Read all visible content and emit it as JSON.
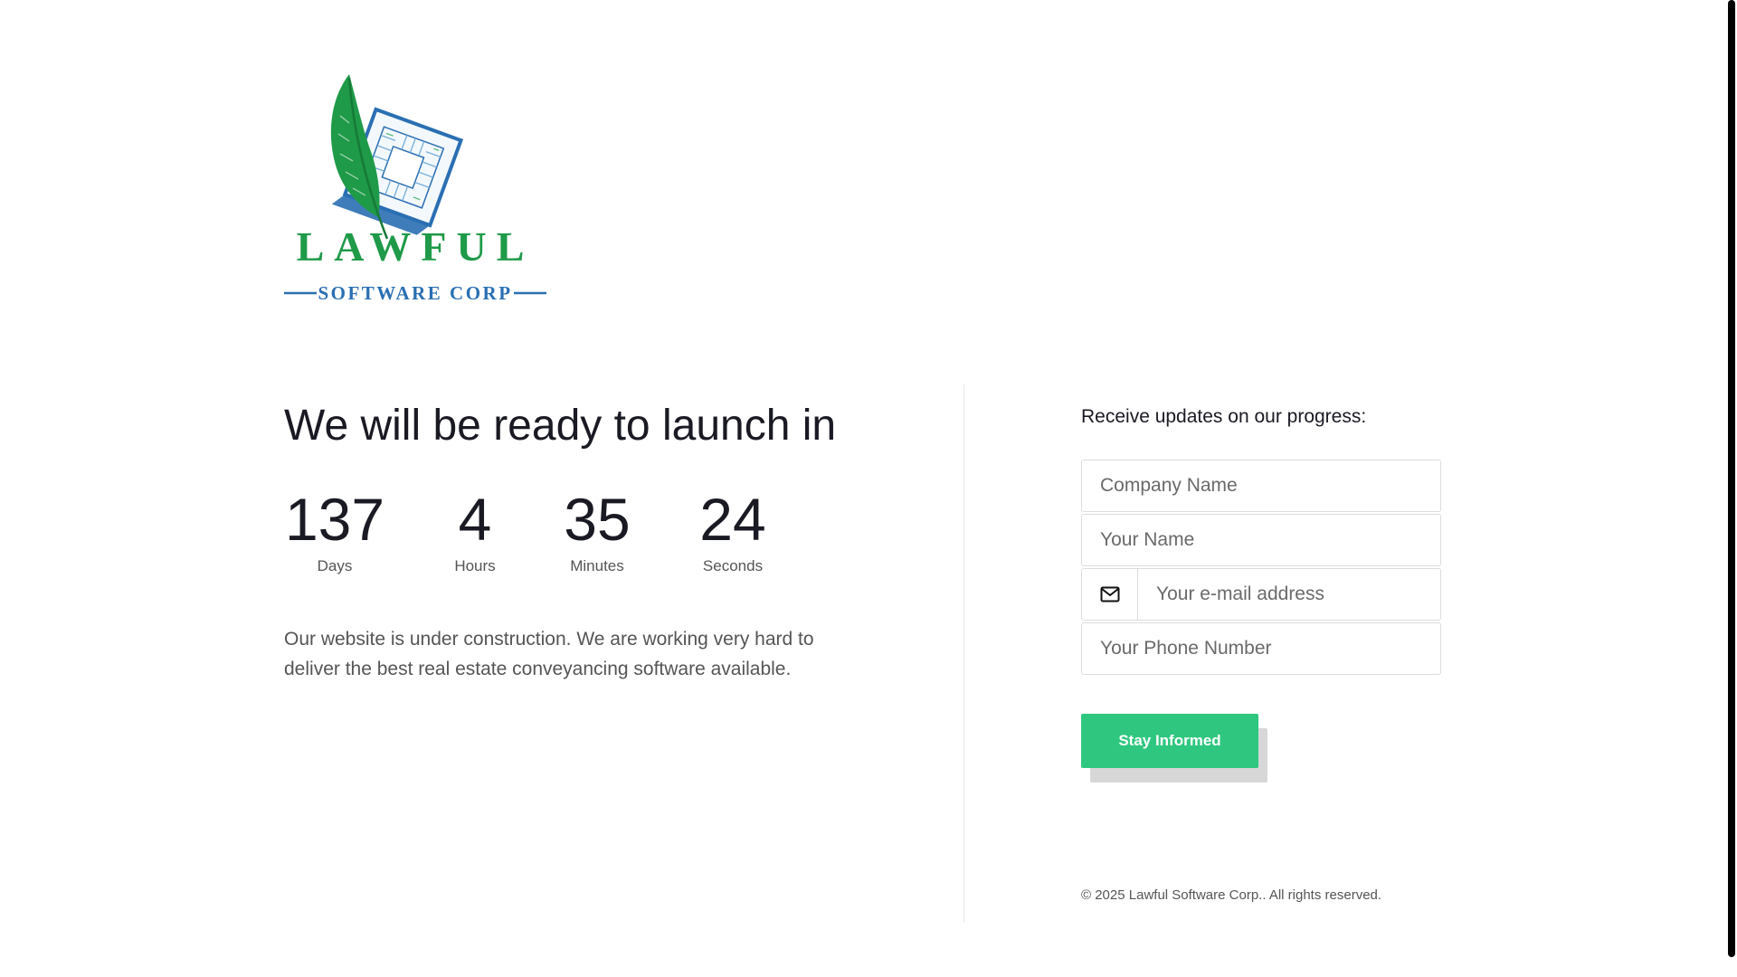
{
  "logo": {
    "wordmark": "LAWFUL",
    "subtitle": "SOFTWARE CORP",
    "icon": "quill-circuit-logo",
    "colors": {
      "green": "#1f9a48",
      "blue": "#2a6fb3"
    }
  },
  "countdown": {
    "headline": "We will be ready to launch in",
    "units": [
      {
        "value": "137",
        "label": "Days"
      },
      {
        "value": "4",
        "label": "Hours"
      },
      {
        "value": "35",
        "label": "Minutes"
      },
      {
        "value": "24",
        "label": "Seconds"
      }
    ]
  },
  "description": "Our website is under construction. We are working very hard to deliver the best real estate conveyancing software available.",
  "signup": {
    "title": "Receive updates on our progress:",
    "fields": {
      "company": {
        "placeholder": "Company Name",
        "value": ""
      },
      "name": {
        "placeholder": "Your Name",
        "value": ""
      },
      "email": {
        "placeholder": "Your e-mail address",
        "value": "",
        "icon": "envelope-icon"
      },
      "phone": {
        "placeholder": "Your Phone Number",
        "value": ""
      }
    },
    "submit_label": "Stay Informed",
    "button_color": "#2fc77f"
  },
  "footer": {
    "copyright": "© 2025 Lawful Software Corp.. All rights reserved."
  }
}
